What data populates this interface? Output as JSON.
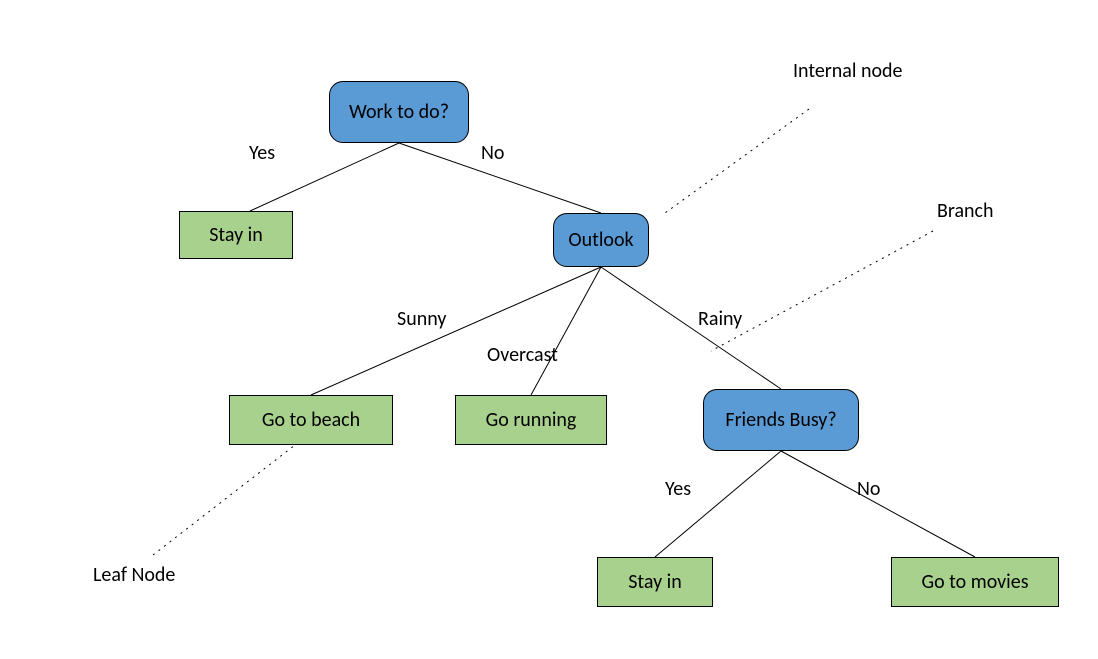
{
  "annotations": {
    "internal_node": "Internal node",
    "branch": "Branch",
    "leaf_node": "Leaf Node"
  },
  "nodes": {
    "root": {
      "text": "Work to do?"
    },
    "outlook": {
      "text": "Outlook"
    },
    "friends": {
      "text": "Friends Busy?"
    },
    "stay_in_1": {
      "text": "Stay in"
    },
    "go_beach": {
      "text": "Go to beach"
    },
    "go_running": {
      "text": "Go running"
    },
    "stay_in_2": {
      "text": "Stay in"
    },
    "go_movies": {
      "text": "Go to movies"
    }
  },
  "edges": {
    "root_yes": "Yes",
    "root_no": "No",
    "outlook_sunny": "Sunny",
    "outlook_over": "Overcast",
    "outlook_rainy": "Rainy",
    "friends_yes": "Yes",
    "friends_no": "No"
  }
}
